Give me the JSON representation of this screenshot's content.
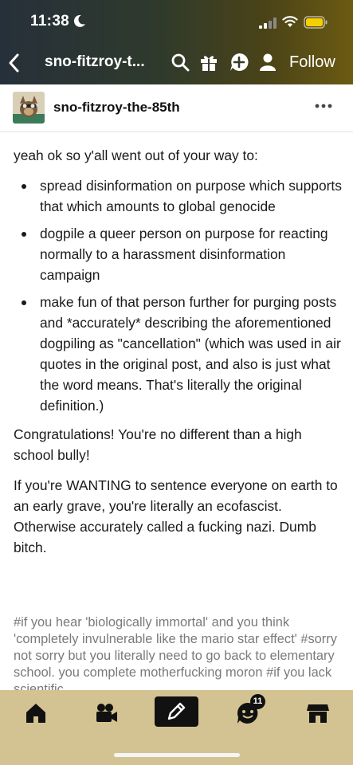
{
  "status_bar": {
    "time": "11:38"
  },
  "nav": {
    "title": "sno-fitzroy-t...",
    "follow_label": "Follow"
  },
  "blog": {
    "name": "sno-fitzroy-the-85th"
  },
  "post": {
    "intro": "yeah ok so y'all went out of your way to:",
    "bullets": [
      "spread disinformation on purpose which supports that which amounts to global genocide",
      "dogpile a queer person on purpose for reacting normally to a harassment disinformation campaign",
      "make fun of that person further for purging posts and *accurately* describing the aforementioned dogpiling as \"cancellation\" (which was used in air quotes in the original post, and also is just what the word means. That's literally the original definition.)"
    ],
    "paragraphs": [
      "Congratulations! You're no different than a high school bully!",
      "If you're WANTING to sentence everyone on earth to an early grave, you're literally an ecofascist. Otherwise accurately called a fucking nazi. Dumb bitch."
    ],
    "tags": [
      "#if you hear 'biologically immortal' and you think 'completely invulnerable like the mario star effect'",
      "#sorry not sorry but you literally need to go back to elementary school. you complete",
      "motherfucking moron",
      "#if you lack scientific"
    ]
  },
  "tabbar": {
    "badge_count": "11"
  },
  "colors": {
    "tabbar_bg": "#d4c392",
    "battery": "#f5d000"
  }
}
